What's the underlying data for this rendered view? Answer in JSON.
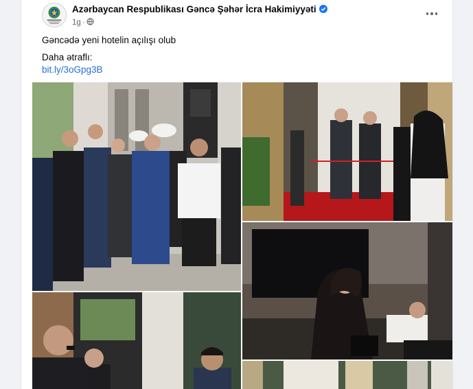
{
  "post": {
    "page_name": "Azərbaycan Respublikası Gəncə Şəhər İcra Hakimiyyəti",
    "timestamp": "1g",
    "privacy_icon": "globe-icon",
    "verified_icon": "verified-badge-icon",
    "avatar_icon": "emblem-icon",
    "menu_icon": "more-options-icon",
    "text": "Gəncədə yeni hotelin açılışı olub",
    "more_label": "Daha ətraflı:",
    "link": "bit.ly/3oGpg3B",
    "accent_color": "#216fdb",
    "verified_color": "#1877f2"
  },
  "photos": [
    {
      "id": "photo-group-outside-hotel"
    },
    {
      "id": "photo-ribbon-cutting"
    },
    {
      "id": "photo-singer-performance"
    },
    {
      "id": "photo-speaker-microphone"
    },
    {
      "id": "photo-hotel-interior"
    }
  ]
}
